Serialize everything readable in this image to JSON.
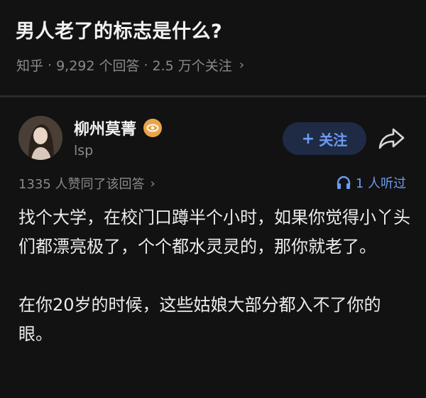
{
  "question": {
    "title": "男人老了的标志是什么?",
    "source": "知乎",
    "answers": "9,292 个回答",
    "follows": "2.5 万个关注",
    "separator": "·",
    "chevron": "›"
  },
  "author": {
    "name": "柳州莫菁",
    "bio": "lsp",
    "badge_icon": "eye-badge-icon",
    "avatar_icon": "user-avatar"
  },
  "actions": {
    "follow_label": "关注",
    "follow_plus": "+",
    "share_icon": "share-icon"
  },
  "stats": {
    "agree": "1335 人赞同了该回答",
    "chevron": "›",
    "listen": "1 人听过",
    "listen_icon": "headphones-icon"
  },
  "answer": {
    "paragraphs": [
      "找个大学，在校门口蹲半个小时，如果你觉得小丫头们都漂亮极了，个个都水灵灵的，那你就老了。",
      "在你20岁的时候，这些姑娘大部分都入不了你的眼。"
    ]
  },
  "colors": {
    "background": "#121212",
    "accent": "#6d9cf2",
    "muted": "#8a8a8a",
    "badge": "#e9a54a"
  }
}
